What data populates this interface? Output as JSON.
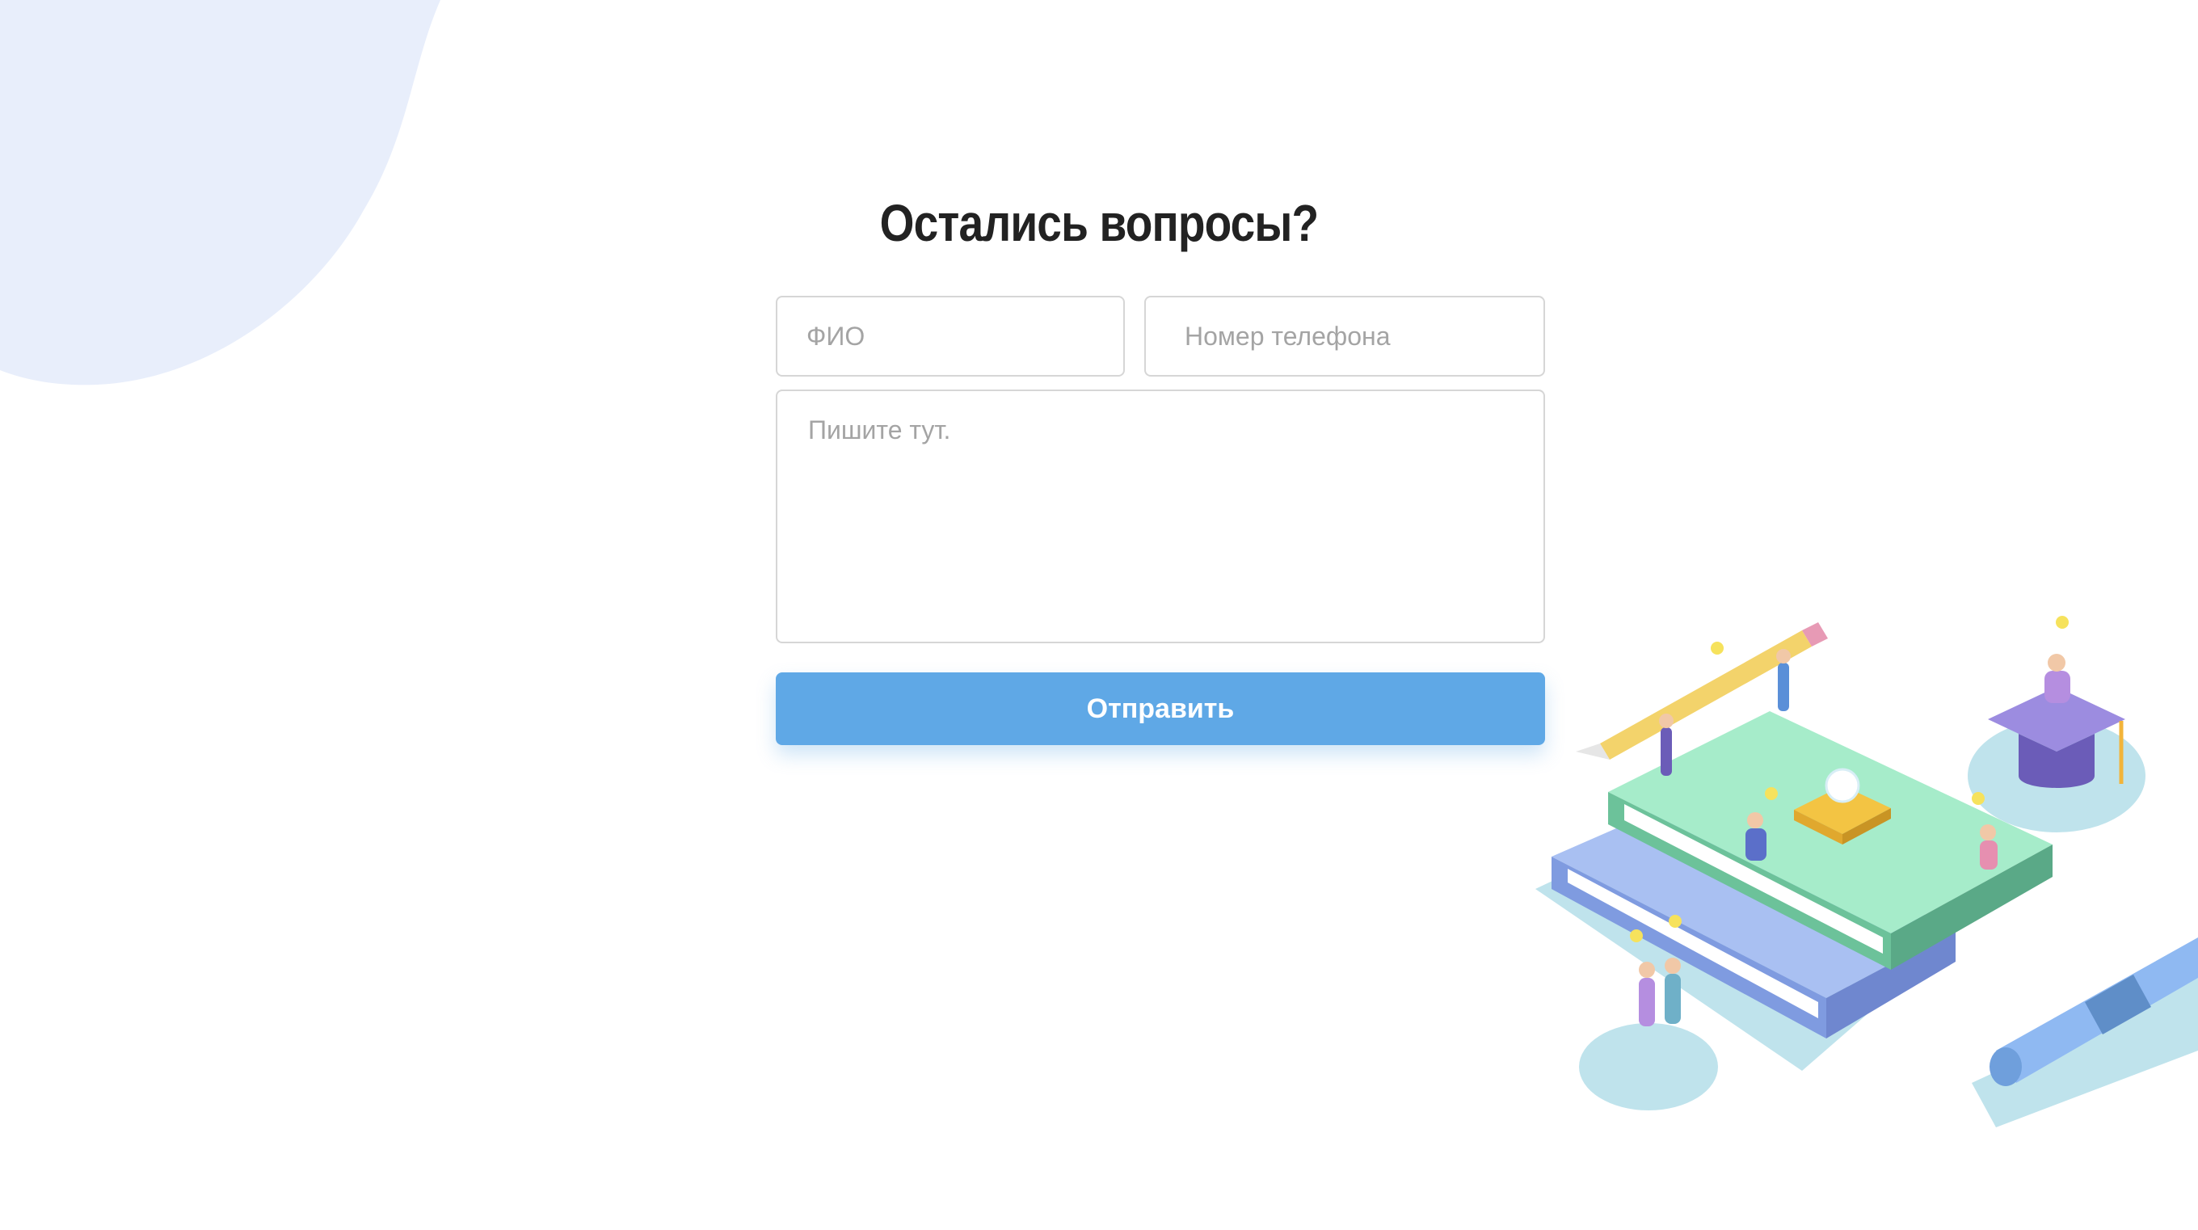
{
  "form": {
    "title": "Остались вопросы?",
    "name_placeholder": "ФИО",
    "phone_placeholder": "Номер телефона",
    "message_placeholder": "Пишите тут.",
    "submit_label": "Отправить"
  },
  "colors": {
    "blob": "#e8eefb",
    "button": "#5fa8e6",
    "title": "#222222"
  },
  "icons": [
    "education-illustration"
  ]
}
